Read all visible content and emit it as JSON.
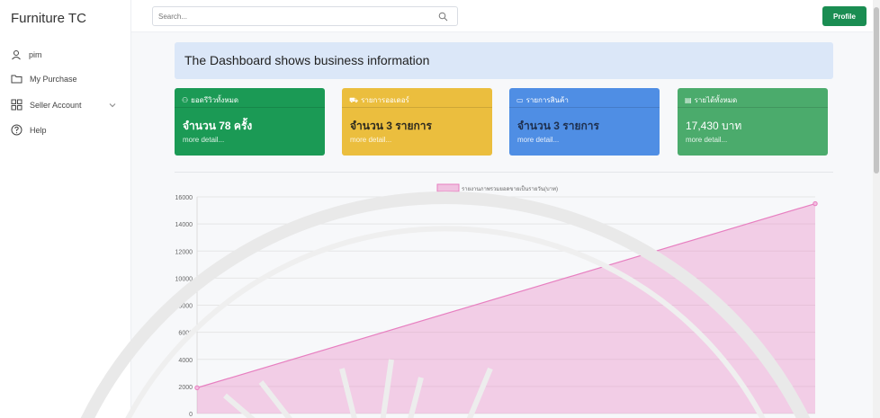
{
  "sidebar": {
    "brand": "Furniture TC",
    "items": [
      {
        "label": "pim",
        "icon": "user-icon"
      },
      {
        "label": "My Purchase",
        "icon": "folder-icon"
      },
      {
        "label": "Seller Account",
        "icon": "grid-icon"
      },
      {
        "label": "Help",
        "icon": "help-icon"
      }
    ]
  },
  "topbar": {
    "search_placeholder": "Search...",
    "profile_label": "Profile"
  },
  "main": {
    "heading": "The Dashboard shows business information",
    "cards": [
      {
        "title": "ยอดรีวิวทั้งหมด",
        "value": "จำนวน 78 ครั้ง",
        "link": "more detail...",
        "color": "#1b9a55"
      },
      {
        "title": "รายการออเดอร์",
        "value": "จำนวน 3 รายการ",
        "link": "more detail...",
        "color": "#ebbe3e"
      },
      {
        "title": "รายการสินค้า",
        "value": "จำนวน 3 รายการ",
        "link": "more detail...",
        "color": "#4f8ee4"
      },
      {
        "title": "รายได้ทั้งหมด",
        "value": "17,430 บาท",
        "link": "more detail...",
        "color": "#4bab6c"
      }
    ]
  },
  "chart_data": {
    "type": "area",
    "series": [
      {
        "name": "รายงานภาพรวมยอดขายเป็นรายวัน(บาท)",
        "x": [
          0,
          1
        ],
        "values": [
          1900,
          15500
        ],
        "color": "#e77fc0"
      }
    ],
    "yticks": [
      0,
      2000,
      4000,
      6000,
      8000,
      10000,
      12000,
      14000,
      16000
    ],
    "ylim": [
      0,
      16000
    ],
    "grid": true,
    "legend": "top-center"
  }
}
